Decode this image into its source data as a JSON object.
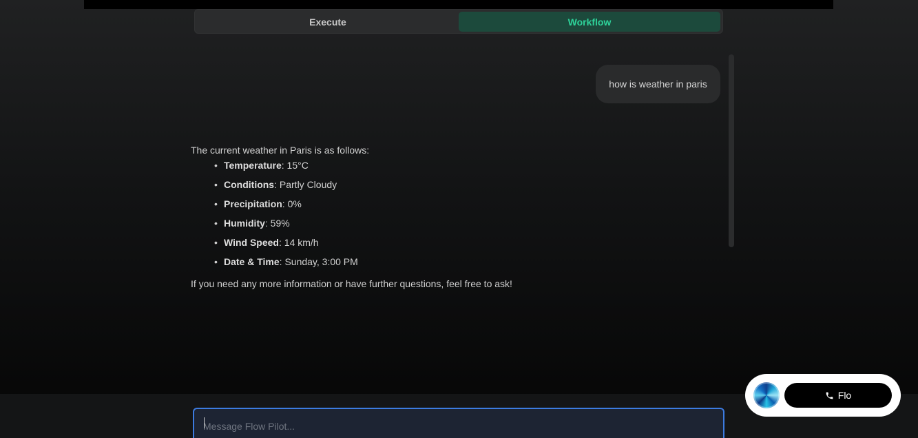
{
  "tabs": {
    "execute_label": "Execute",
    "workflow_label": "Workflow"
  },
  "conversation": {
    "user_message": "how is weather in paris",
    "assistant": {
      "intro": "The current weather in Paris is as follows:",
      "items": [
        {
          "label": "Temperature",
          "value": ": 15°C"
        },
        {
          "label": "Conditions",
          "value": ": Partly Cloudy"
        },
        {
          "label": "Precipitation",
          "value": ": 0%"
        },
        {
          "label": "Humidity",
          "value": ": 59%"
        },
        {
          "label": "Wind Speed",
          "value": ": 14 km/h"
        },
        {
          "label": "Date & Time",
          "value": ": Sunday, 3:00 PM"
        }
      ],
      "outro": "If you need any more information or have further questions, feel free to ask!"
    }
  },
  "composer": {
    "placeholder": "Message Flow Pilot...",
    "value": ""
  },
  "flo_widget": {
    "button_label": "Flo",
    "icon": "phone-icon",
    "avatar_icon": "flo-avatar-orb"
  },
  "colors": {
    "accent_green": "#2ed39a",
    "workflow_tab_bg": "#1c4a3c",
    "input_focus_border": "#3c7be0"
  }
}
